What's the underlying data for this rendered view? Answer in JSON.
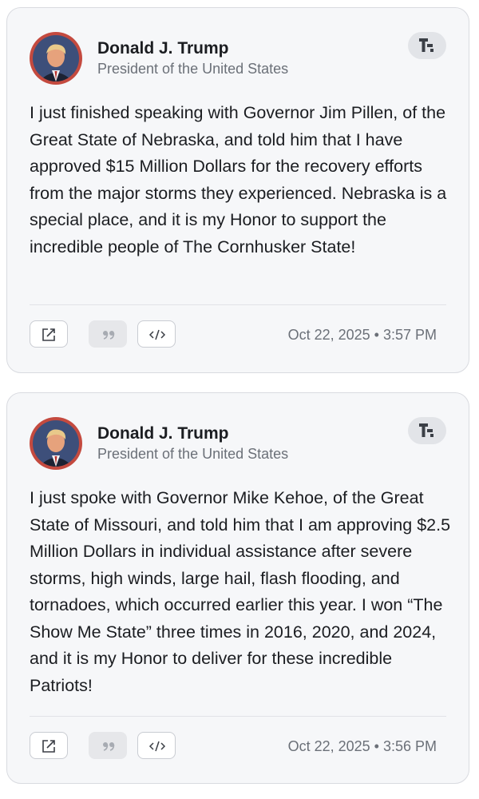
{
  "posts": [
    {
      "author": "Donald J. Trump",
      "subtitle": "President of the United States",
      "text": "I just finished speaking with Governor Jim Pillen, of the Great State of Nebraska, and told him that I have approved $15 Million Dollars for the recovery efforts from the major storms they experienced. Nebraska is a special place, and it is my Honor to support the incredible people of The Cornhusker State!",
      "timestamp": "Oct 22, 2025 • 3:57 PM",
      "icons": {
        "brand": "truth-social-logo-icon",
        "share": "external-link-icon",
        "quote": "quote-icon",
        "embed": "code-icon"
      }
    },
    {
      "author": "Donald J. Trump",
      "subtitle": "President of the United States",
      "text": "I just spoke with Governor Mike Kehoe, of the Great State of Missouri, and told him that I am approving $2.5 Million Dollars in individual assistance after severe storms, high winds, large hail, flash flooding, and tornadoes, which occurred earlier this year. I won “The Show Me State” three times in 2016, 2020, and 2024, and it is my Honor to deliver for these incredible Patriots!",
      "timestamp": "Oct 22, 2025 • 3:56 PM",
      "icons": {
        "brand": "truth-social-logo-icon",
        "share": "external-link-icon",
        "quote": "quote-icon",
        "embed": "code-icon"
      }
    }
  ],
  "colors": {
    "card_background": "#f6f7f9",
    "card_border": "#d9dbe0",
    "avatar_ring": "#c44a3f",
    "muted_text": "#6b7078"
  }
}
